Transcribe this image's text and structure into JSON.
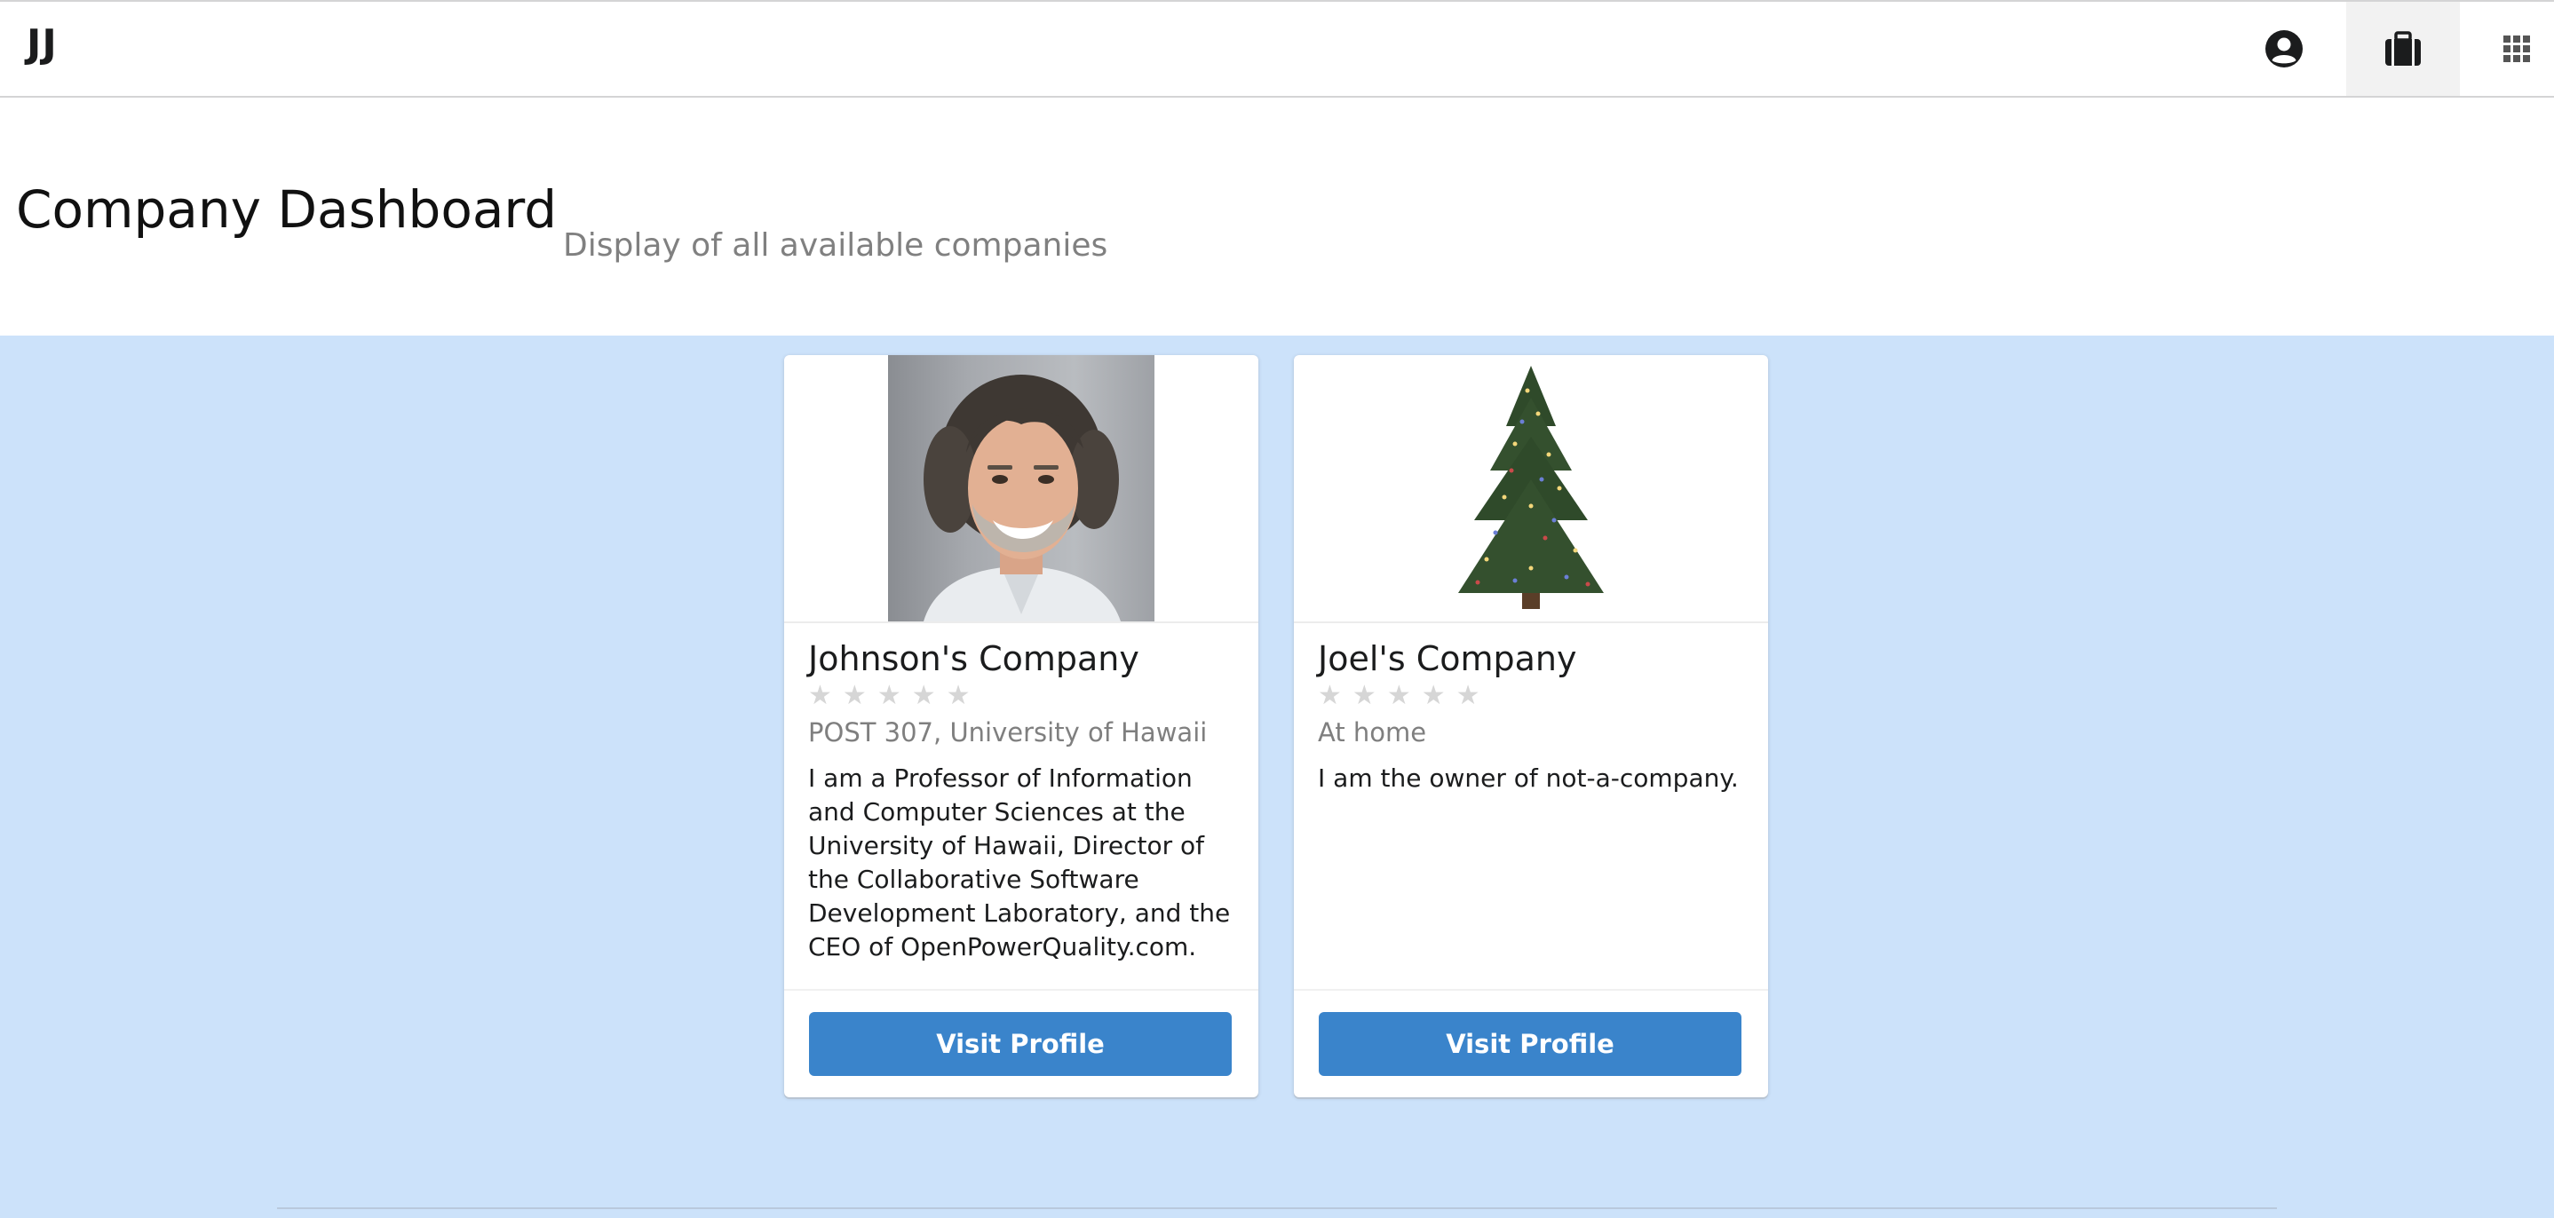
{
  "navbar": {
    "brand": "JJ",
    "icons": [
      "user-circle-icon",
      "briefcase-icon",
      "grid-icon"
    ]
  },
  "header": {
    "title": "Company Dashboard",
    "subtitle": "Display of all available companies"
  },
  "companies": [
    {
      "name": "Johnson's Company",
      "rating": 0,
      "rating_max": 5,
      "location": "POST 307, University of Hawaii",
      "description": "I am a Professor of Information and Computer Sciences at the University of Hawaii, Director of the Collaborative Software Development Laboratory, and the CEO of OpenPowerQuality.com.",
      "button_label": "Visit Profile",
      "image": "portrait-photo"
    },
    {
      "name": "Joel's Company",
      "rating": 0,
      "rating_max": 5,
      "location": "At home",
      "description": "I am the owner of not-a-company.",
      "button_label": "Visit Profile",
      "image": "christmas-tree-photo"
    }
  ],
  "colors": {
    "page_background": "#cce2fa",
    "button": "#3a84cb",
    "star_empty": "#d6d6d6"
  }
}
